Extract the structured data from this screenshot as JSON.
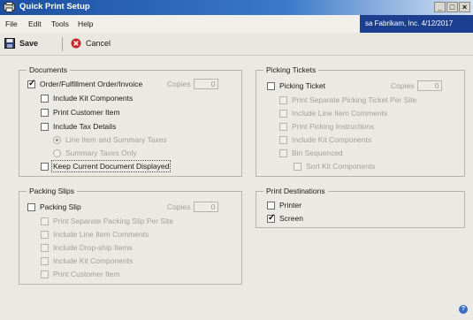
{
  "window": {
    "title": "Quick Print Setup"
  },
  "menu": [
    "File",
    "Edit",
    "Tools",
    "Help"
  ],
  "company": "sa  Fabrikam, Inc.  4/12/2017",
  "toolbar": {
    "save_label": "Save",
    "cancel_label": "Cancel"
  },
  "documents": {
    "title": "Documents",
    "order_label": "Order/Fulfillment Order/Invoice",
    "order_checked": true,
    "copies_label": "Copies",
    "copies_value": "0",
    "include_kit": "Include Kit Components",
    "print_customer_item": "Print Customer Item",
    "include_tax": "Include Tax Details",
    "tax_option_line": "Line Item and Summary Taxes",
    "tax_option_summary": "Summary Taxes Only",
    "keep_current": "Keep Current Document Displayed"
  },
  "packing": {
    "title": "Packing Slips",
    "slip_label": "Packing Slip",
    "copies_label": "Copies",
    "copies_value": "0",
    "options": [
      "Print Separate Packing Slip Per Site",
      "Include Line Item Comments",
      "Include Drop-ship Items",
      "Include Kit Components",
      "Print Customer Item"
    ]
  },
  "picking": {
    "title": "Picking Tickets",
    "ticket_label": "Picking Ticket",
    "copies_label": "Copies",
    "copies_value": "0",
    "options": [
      "Print Separate Picking Ticket Per Site",
      "Include Line Item Comments",
      "Print Picking Instructions",
      "Include Kit Components",
      "Bin Sequenced"
    ],
    "sort_kit": "Sort Kit Components"
  },
  "destinations": {
    "title": "Print Destinations",
    "printer": "Printer",
    "printer_checked": false,
    "screen": "Screen",
    "screen_checked": true
  },
  "colors": {
    "titlebar": "#1d4fa0",
    "banner": "#1d3f8f",
    "background": "#ebe9e3"
  },
  "icons": [
    "app-icon",
    "save-icon",
    "cancel-icon",
    "help-icon"
  ]
}
